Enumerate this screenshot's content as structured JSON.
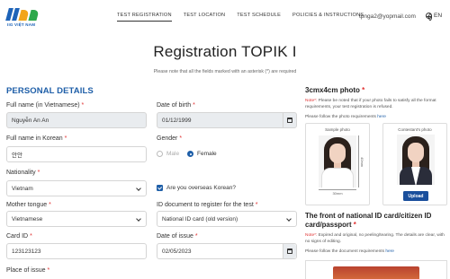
{
  "brand": {
    "logo_text": "IIG VIỆT NAM",
    "primary_color": "#1f5fa8"
  },
  "nav": {
    "items": [
      {
        "label": "TEST REGISTRATION",
        "active": true
      },
      {
        "label": "TEST LOCATION",
        "active": false
      },
      {
        "label": "TEST SCHEDULE",
        "active": false
      },
      {
        "label": "POLICIES & INSTRUCTIONS",
        "active": false
      }
    ],
    "user_email": "tpnga2@yopmail.com",
    "language": "EN"
  },
  "page": {
    "title": "Registration TOPIK I",
    "note": "Please note that all the fields marked with an asterisk (*) are required"
  },
  "personal": {
    "section_title": "PERSONAL DETAILS",
    "full_name_vi": {
      "label": "Full name (in Vietnamese)",
      "value": "Nguyễn An An"
    },
    "dob": {
      "label": "Date of birth",
      "value": "01/12/1999"
    },
    "full_name_ko": {
      "label": "Full name in Korean",
      "value": "안안"
    },
    "gender": {
      "label": "Gender",
      "options": [
        "Male",
        "Female"
      ],
      "selected": "Female"
    },
    "nationality": {
      "label": "Nationality",
      "value": "Vietnam"
    },
    "overseas": {
      "label": "Are you overseas Korean?",
      "checked": true
    },
    "mother_tongue": {
      "label": "Mother tongue",
      "value": "Vietnamese"
    },
    "id_document": {
      "label": "ID document to register for the test",
      "value": "National ID card (old version)"
    },
    "card_id": {
      "label": "Card ID",
      "value": "123123123"
    },
    "date_issue": {
      "label": "Date of issue",
      "value": "02/05/2023"
    },
    "place_issue": {
      "label": "Place of issue"
    }
  },
  "photo": {
    "title": "3cmx4cm photo",
    "note_prefix": "Note*:",
    "note_text": " Please be noted that if your photo fails to satisfy all the format requirements, your test registration is refused.",
    "follow_text": "Please follow the photo requirements ",
    "follow_link": "here",
    "sample_label": "Sample photo",
    "contestant_label": "Contestant's photo",
    "dim_width": "30mm",
    "dim_height": "40mm",
    "upload_label": "Upload"
  },
  "id_card": {
    "title": "The front of national ID card/citizen ID card/passport",
    "note_prefix": "Note*:",
    "note_text": " Expired and original, no peeling/tearing. The details are clear, with no signs of editing.",
    "follow_text": "Please follow the document requirements ",
    "follow_link": "here"
  }
}
